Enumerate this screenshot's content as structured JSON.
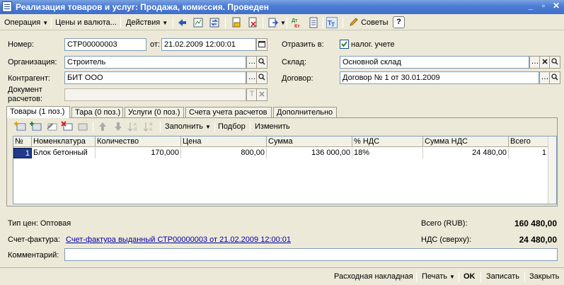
{
  "window": {
    "title": "Реализация товаров и услуг: Продажа, комиссия. Проведен"
  },
  "toolbar": {
    "operation": "Операция",
    "prices": "Цены и валюта...",
    "actions": "Действия",
    "tips": "Советы",
    "help": "?"
  },
  "form": {
    "number_label": "Номер:",
    "number_value": "СТР00000003",
    "date_label": "от:",
    "date_value": "21.02.2009 12:00:01",
    "reflect_label": "Отразить в:",
    "tax_label": "налог. учете",
    "org_label": "Организация:",
    "org_value": "Строитель",
    "warehouse_label": "Склад:",
    "warehouse_value": "Основной склад",
    "contractor_label": "Контрагент:",
    "contractor_value": "БИТ ООО",
    "contract_label": "Договор:",
    "contract_value": "Договор № 1 от 30.01.2009",
    "settle_doc_label_1": "Документ",
    "settle_doc_label_2": "расчетов:"
  },
  "tabs": [
    {
      "label": "Товары (1 поз.)"
    },
    {
      "label": "Тара (0 поз.)"
    },
    {
      "label": "Услуги (0 поз.)"
    },
    {
      "label": "Счета учета расчетов"
    },
    {
      "label": "Дополнительно"
    }
  ],
  "table_toolbar": {
    "fill": "Заполнить",
    "selection": "Подбор",
    "change": "Изменить"
  },
  "table": {
    "columns": [
      "№",
      "Номенклатура",
      "Количество",
      "Цена",
      "Сумма",
      "% НДС",
      "Сумма НДС",
      "Всего"
    ],
    "rows": [
      [
        "1",
        "Блок бетонный",
        "170,000",
        "800,00",
        "136 000,00",
        "18%",
        "24 480,00",
        "1"
      ]
    ]
  },
  "summary": {
    "price_type": "Тип цен: Оптовая",
    "total_label": "Всего (RUB):",
    "total_value": "160 480,00",
    "invoice_label": "Счет-фактура:",
    "invoice_link": "Счет-фактура выданный СТР00000003 от 21.02.2009 12:00:01",
    "vat_label": "НДС (сверху):",
    "vat_value": "24 480,00",
    "comment_label": "Комментарий:",
    "comment_value": ""
  },
  "bottom": {
    "waybill": "Расходная накладная",
    "print": "Печать",
    "ok": "OK",
    "save": "Записать",
    "close": "Закрыть"
  },
  "colors": {
    "titlebar": "#3f6fc9",
    "window_bg": "#ece9d8",
    "link": "#0000aa",
    "selection": "#1f3a8a"
  }
}
